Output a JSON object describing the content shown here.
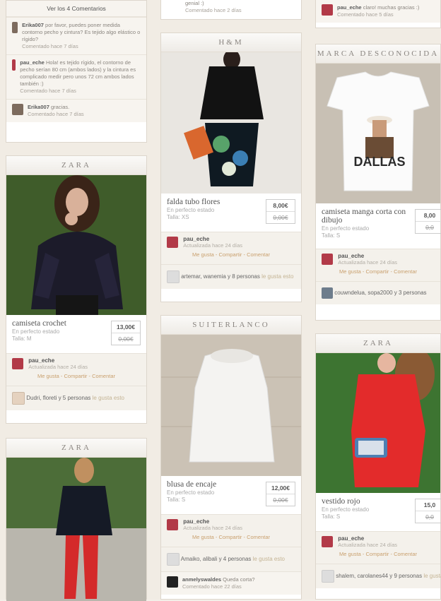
{
  "col1": {
    "top_comments": {
      "view_all": "Ver los 4 Comentarios",
      "items": [
        {
          "user": "Erika007",
          "text": "por favor, puedes poner medida contorno pecho y cintura? Es tejido algo elástico o rígido?",
          "time": "Comentado hace 7 días"
        },
        {
          "user": "pau_eche",
          "text": "Hola! es tejido rígido, el contorno de pecho serían 80 cm (ambos lados) y la cintura es complicado medir pero unos 72 cm ambos lados también :)",
          "time": "Comentado hace 7 días"
        },
        {
          "user": "Erika007",
          "text": "gracias.",
          "time": "Comentado hace 7 días"
        }
      ]
    },
    "card1": {
      "brand": "ZARA",
      "title": "camiseta crochet",
      "state": "En perfecto estado",
      "size": "Talla: M",
      "price": "13,00€",
      "old": "0,00€",
      "user": "pau_eche",
      "updated": "Actualizada hace 24 días",
      "actions": "Me gusta - Compartir - Comentar",
      "likes": "Dudri, floreti y 5 personas",
      "likes_tail": "le gusta esto"
    },
    "card2": {
      "brand": "ZARA"
    }
  },
  "col2": {
    "top": {
      "frag": "genial :)",
      "time": "Comentado hace 2 días"
    },
    "card1": {
      "brand": "H&M",
      "title": "falda tubo flores",
      "state": "En perfecto estado",
      "size": "Talla: XS",
      "price": "8,00€",
      "old": "0,00€",
      "user": "pau_eche",
      "updated": "Actualizada hace 24 días",
      "actions": "Me gusta - Compartir - Comentar",
      "likes": "artemar, wanemia y 8 personas",
      "likes_tail": "le gusta esto"
    },
    "card2": {
      "brand": "SUITERLANCO",
      "title": "blusa de encaje",
      "state": "En perfecto estado",
      "size": "Talla: S",
      "price": "12,00€",
      "old": "0,00€",
      "user": "pau_eche",
      "updated": "Actualizada hace 24 días",
      "actions": "Me gusta - Compartir - Comentar",
      "likes": "Amaiko, alibali y 4 personas",
      "likes_tail": "le gusta esto",
      "c_user": "anmelyswaldes",
      "c_text": "Queda corta?",
      "c_time": "Comentado hace 22 días"
    }
  },
  "col3": {
    "top": {
      "user": "pau_eche",
      "text": "claro! muchas gracias :)",
      "time": "Comentado hace 5 días"
    },
    "card1": {
      "brand": "MARCA DESCONOCIDA",
      "title": "camiseta manga corta con dibujo",
      "state": "En perfecto estado",
      "size": "Talla: S",
      "price": "8,00",
      "old": "0,0",
      "user": "pau_eche",
      "updated": "Actualizada hace 24 días",
      "actions": "Me gusta - Compartir - Comentar",
      "likes": "couwndelua, sopa2000 y 3 personas",
      "shirt_text": "DALLAS"
    },
    "card2": {
      "brand": "ZARA",
      "title": "vestido rojo",
      "state": "En perfecto estado",
      "size": "Talla: S",
      "price": "15,0",
      "old": "0,0",
      "user": "pau_eche",
      "updated": "Actualizada hace 24 días",
      "actions": "Me gusta - Compartir - Comentar",
      "likes": "shalem, carolanes44 y 9 personas",
      "likes_tail": "le gusta esto"
    }
  },
  "colors": {
    "accent": "#c9a06e",
    "bg": "#f1ece4"
  }
}
